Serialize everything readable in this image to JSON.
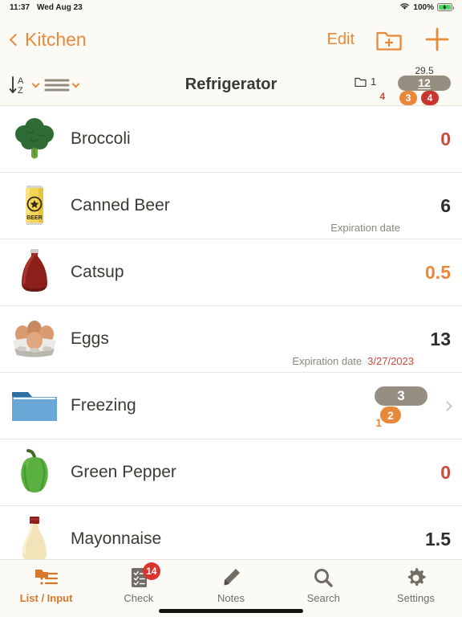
{
  "status_bar": {
    "time": "11:37",
    "date": "Wed Aug 23",
    "battery_percent": "100%",
    "wifi_icon": "wifi-icon",
    "battery_icon": "battery-charging-icon"
  },
  "nav_bar": {
    "back_label": "Kitchen",
    "back_icon": "chevron-left-icon",
    "edit_label": "Edit",
    "new_folder_icon": "folder-plus-icon",
    "add_icon": "plus-icon"
  },
  "toolbar": {
    "title": "Refrigerator",
    "sort_icon": "sort-az-icon",
    "sort_caret_icon": "chevron-down-icon",
    "layout_icon": "list-lines-icon",
    "layout_caret_icon": "chevron-down-icon",
    "folder_icon": "folder-icon",
    "folder_count": "1",
    "folder_sub_count": "4",
    "total_value": "29.5",
    "item_count": "12",
    "warn_count": "3",
    "alert_count": "4"
  },
  "colors": {
    "accent_orange": "#e8893a",
    "alert_red": "#c94a3e",
    "badge_red": "#c9352f",
    "pill_gray": "#968f81",
    "text_dark": "#3b3a32",
    "bg_cream": "#fbfaf5"
  },
  "items": [
    {
      "name": "Broccoli",
      "icon": "broccoli-icon",
      "quantity": "0",
      "qty_style": "red",
      "type": "item"
    },
    {
      "name": "Canned Beer",
      "icon": "beer-can-icon",
      "quantity": "6",
      "qty_style": "normal",
      "type": "item",
      "exp_label": "Expiration date",
      "exp_date": ""
    },
    {
      "name": "Catsup",
      "icon": "ketchup-bottle-icon",
      "quantity": "0.5",
      "qty_style": "orange",
      "type": "item"
    },
    {
      "name": "Eggs",
      "icon": "egg-carton-icon",
      "quantity": "13",
      "qty_style": "normal",
      "type": "item",
      "exp_label": "Expiration date",
      "exp_date": "3/27/2023"
    },
    {
      "name": "Freezing",
      "icon": "folder-blue-icon",
      "type": "folder",
      "sub_count": "1",
      "pill_count": "3",
      "warn_count": "2",
      "chevron_icon": "chevron-right-icon"
    },
    {
      "name": "Green Pepper",
      "icon": "green-pepper-icon",
      "quantity": "0",
      "qty_style": "red",
      "type": "item"
    },
    {
      "name": "Mayonnaise",
      "icon": "mayonnaise-bottle-icon",
      "quantity": "1.5",
      "qty_style": "normal",
      "type": "item"
    }
  ],
  "tab_bar": {
    "tabs": [
      {
        "label": "List / Input",
        "icon": "list-input-icon",
        "active": true,
        "badge": ""
      },
      {
        "label": "Check",
        "icon": "checklist-icon",
        "active": false,
        "badge": "14"
      },
      {
        "label": "Notes",
        "icon": "pencil-icon",
        "active": false,
        "badge": ""
      },
      {
        "label": "Search",
        "icon": "search-icon",
        "active": false,
        "badge": ""
      },
      {
        "label": "Settings",
        "icon": "gear-icon",
        "active": false,
        "badge": ""
      }
    ]
  }
}
